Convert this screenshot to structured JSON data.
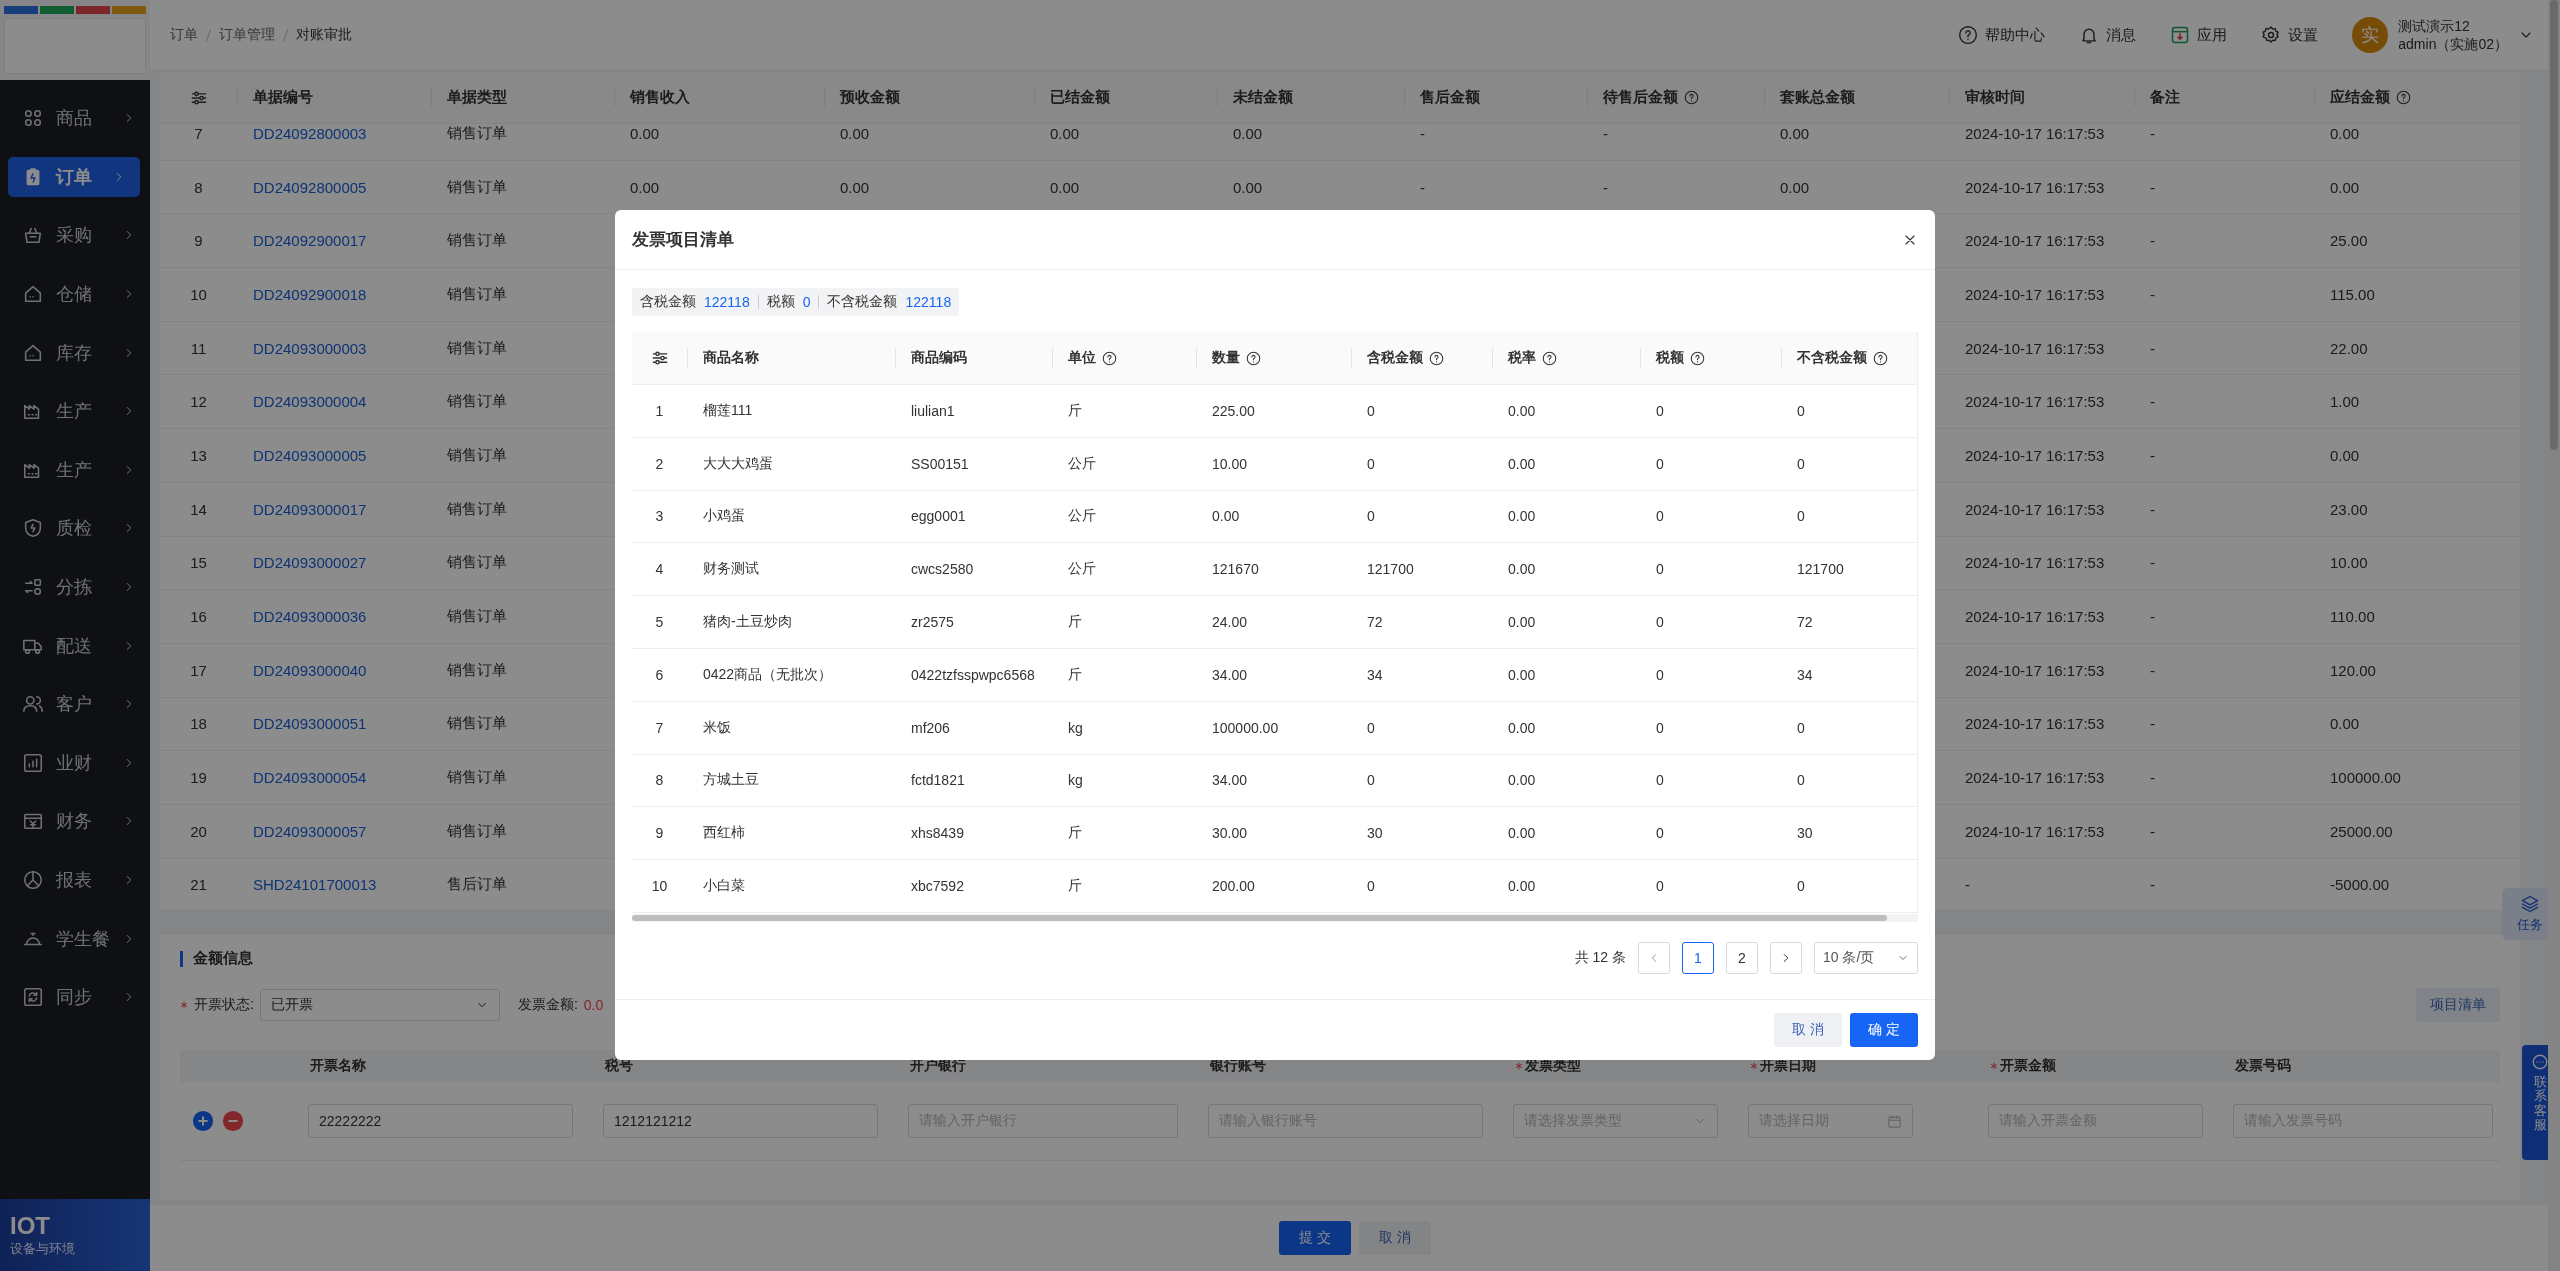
{
  "sidebar": {
    "items": [
      {
        "label": "商品",
        "selected": false
      },
      {
        "label": "订单",
        "selected": true
      },
      {
        "label": "采购",
        "selected": false
      },
      {
        "label": "仓储",
        "selected": false
      },
      {
        "label": "库存",
        "selected": false
      },
      {
        "label": "生产",
        "selected": false
      },
      {
        "label": "生产",
        "selected": false
      },
      {
        "label": "质检",
        "selected": false
      },
      {
        "label": "分拣",
        "selected": false
      },
      {
        "label": "配送",
        "selected": false
      },
      {
        "label": "客户",
        "selected": false
      },
      {
        "label": "业财",
        "selected": false
      },
      {
        "label": "财务",
        "selected": false
      },
      {
        "label": "报表",
        "selected": false
      },
      {
        "label": "学生餐",
        "selected": false
      },
      {
        "label": "同步",
        "selected": false
      }
    ],
    "footer": {
      "title": "IOT",
      "subtitle": "设备与环境"
    }
  },
  "header": {
    "breadcrumb": [
      "订单",
      "订单管理",
      "对账审批"
    ],
    "actions": [
      "帮助中心",
      "消息",
      "应用",
      "设置"
    ],
    "user": {
      "avatar": "实",
      "name": "测试演示12",
      "role": "admin（实施02）"
    }
  },
  "orders_table": {
    "columns": [
      {
        "kind": "index"
      },
      {
        "label": "单据编号",
        "kind": "link",
        "help": false
      },
      {
        "label": "单据类型",
        "kind": "text",
        "help": false
      },
      {
        "label": "销售收入",
        "kind": "text",
        "help": false
      },
      {
        "label": "预收金额",
        "kind": "text",
        "help": false
      },
      {
        "label": "已结金额",
        "kind": "text",
        "help": false
      },
      {
        "label": "未结金额",
        "kind": "text",
        "help": false
      },
      {
        "label": "售后金额",
        "kind": "text",
        "help": false
      },
      {
        "label": "待售后金额",
        "kind": "text",
        "help": true
      },
      {
        "label": "套账总金额",
        "kind": "text",
        "help": false
      },
      {
        "label": "审核时间",
        "kind": "text",
        "help": false
      },
      {
        "label": "备注",
        "kind": "text",
        "help": false
      },
      {
        "label": "应结金额",
        "kind": "text",
        "help": true
      }
    ],
    "rows": [
      [
        "7",
        "DD24092800003",
        "销售订单",
        "0.00",
        "0.00",
        "0.00",
        "0.00",
        "-",
        "-",
        "0.00",
        "2024-10-17 16:17:53",
        "-",
        "0.00"
      ],
      [
        "8",
        "DD24092800005",
        "销售订单",
        "0.00",
        "0.00",
        "0.00",
        "0.00",
        "-",
        "-",
        "0.00",
        "2024-10-17 16:17:53",
        "-",
        "0.00"
      ],
      [
        "9",
        "DD24092900017",
        "销售订单",
        null,
        null,
        null,
        null,
        null,
        null,
        null,
        "2024-10-17 16:17:53",
        "-",
        "25.00"
      ],
      [
        "10",
        "DD24092900018",
        "销售订单",
        null,
        null,
        null,
        null,
        null,
        null,
        null,
        "2024-10-17 16:17:53",
        "-",
        "115.00"
      ],
      [
        "11",
        "DD24093000003",
        "销售订单",
        null,
        null,
        null,
        null,
        null,
        null,
        null,
        "2024-10-17 16:17:53",
        "-",
        "22.00"
      ],
      [
        "12",
        "DD24093000004",
        "销售订单",
        null,
        null,
        null,
        null,
        null,
        null,
        null,
        "2024-10-17 16:17:53",
        "-",
        "1.00"
      ],
      [
        "13",
        "DD24093000005",
        "销售订单",
        null,
        null,
        null,
        null,
        null,
        null,
        null,
        "2024-10-17 16:17:53",
        "-",
        "0.00"
      ],
      [
        "14",
        "DD24093000017",
        "销售订单",
        null,
        null,
        null,
        null,
        null,
        null,
        null,
        "2024-10-17 16:17:53",
        "-",
        "23.00"
      ],
      [
        "15",
        "DD24093000027",
        "销售订单",
        null,
        null,
        null,
        null,
        null,
        null,
        null,
        "2024-10-17 16:17:53",
        "-",
        "10.00"
      ],
      [
        "16",
        "DD24093000036",
        "销售订单",
        null,
        null,
        null,
        null,
        null,
        null,
        null,
        "2024-10-17 16:17:53",
        "-",
        "110.00"
      ],
      [
        "17",
        "DD24093000040",
        "销售订单",
        null,
        null,
        null,
        null,
        null,
        null,
        null,
        "2024-10-17 16:17:53",
        "-",
        "120.00"
      ],
      [
        "18",
        "DD24093000051",
        "销售订单",
        null,
        null,
        null,
        null,
        null,
        null,
        null,
        "2024-10-17 16:17:53",
        "-",
        "0.00"
      ],
      [
        "19",
        "DD24093000054",
        "销售订单",
        null,
        null,
        null,
        null,
        null,
        null,
        null,
        "2024-10-17 16:17:53",
        "-",
        "100000.00"
      ],
      [
        "20",
        "DD24093000057",
        "销售订单",
        null,
        null,
        null,
        null,
        null,
        null,
        null,
        "2024-10-17 16:17:53",
        "-",
        "25000.00"
      ],
      [
        "21",
        "SHD24101700013",
        "售后订单",
        null,
        null,
        null,
        null,
        null,
        null,
        null,
        "-",
        "-",
        "-5000.00"
      ]
    ]
  },
  "amount_info": {
    "title": "金额信息",
    "invoice_status": {
      "label": "开票状态:",
      "required": true,
      "value": "已开票"
    },
    "invoice_amount": {
      "label": "发票金额:",
      "value": "0.0"
    },
    "items_button": "项目清单",
    "invoice_columns": [
      {
        "label": "开票名称",
        "required": false
      },
      {
        "label": "税号",
        "required": false
      },
      {
        "label": "开户银行",
        "required": false
      },
      {
        "label": "银行账号",
        "required": false
      },
      {
        "label": "发票类型",
        "required": true
      },
      {
        "label": "开票日期",
        "required": true
      },
      {
        "label": "开票金额",
        "required": true
      },
      {
        "label": "发票号码",
        "required": false
      }
    ],
    "invoice_row": [
      {
        "kind": "input",
        "value": "22222222"
      },
      {
        "kind": "input",
        "value": "1212121212"
      },
      {
        "kind": "input",
        "placeholder": "请输入开户银行"
      },
      {
        "kind": "input",
        "placeholder": "请输入银行账号"
      },
      {
        "kind": "select",
        "placeholder": "请选择发票类型"
      },
      {
        "kind": "date",
        "placeholder": "请选择日期"
      },
      {
        "kind": "input",
        "placeholder": "请输入开票金额"
      },
      {
        "kind": "input",
        "placeholder": "请输入发票号码"
      }
    ]
  },
  "footer_buttons": [
    {
      "label": "提 交",
      "kind": "primary"
    },
    {
      "label": "取 消",
      "kind": "default"
    }
  ],
  "floating": {
    "task": "任务",
    "support": "联系客服"
  },
  "modal": {
    "title": "发票项目清单",
    "summary": [
      {
        "label": "含税金额",
        "value": "122118"
      },
      {
        "label": "税额",
        "value": "0"
      },
      {
        "label": "不含税金额",
        "value": "122118"
      }
    ],
    "columns": [
      {
        "kind": "index"
      },
      {
        "label": "商品名称",
        "help": false
      },
      {
        "label": "商品编码",
        "help": false
      },
      {
        "label": "单位",
        "help": true
      },
      {
        "label": "数量",
        "help": true
      },
      {
        "label": "含税金额",
        "help": true
      },
      {
        "label": "税率",
        "help": true
      },
      {
        "label": "税额",
        "help": true
      },
      {
        "label": "不含税金额",
        "help": true
      }
    ],
    "rows": [
      [
        "1",
        "榴莲111",
        "liulian1",
        "斤",
        "225.00",
        "0",
        "0.00",
        "0",
        "0"
      ],
      [
        "2",
        "大大大鸡蛋",
        "SS00151",
        "公斤",
        "10.00",
        "0",
        "0.00",
        "0",
        "0"
      ],
      [
        "3",
        "小鸡蛋",
        "egg0001",
        "公斤",
        "0.00",
        "0",
        "0.00",
        "0",
        "0"
      ],
      [
        "4",
        "财务测试",
        "cwcs2580",
        "公斤",
        "121670",
        "121700",
        "0.00",
        "0",
        "121700"
      ],
      [
        "5",
        "猪肉-土豆炒肉",
        "zr2575",
        "斤",
        "24.00",
        "72",
        "0.00",
        "0",
        "72"
      ],
      [
        "6",
        "0422商品（无批次）",
        "0422tzfsspwpc6568",
        "斤",
        "34.00",
        "34",
        "0.00",
        "0",
        "34"
      ],
      [
        "7",
        "米饭",
        "mf206",
        "kg",
        "100000.00",
        "0",
        "0.00",
        "0",
        "0"
      ],
      [
        "8",
        "方城土豆",
        "fctd1821",
        "kg",
        "34.00",
        "0",
        "0.00",
        "0",
        "0"
      ],
      [
        "9",
        "西红柿",
        "xhs8439",
        "斤",
        "30.00",
        "30",
        "0.00",
        "0",
        "30"
      ],
      [
        "10",
        "小白菜",
        "xbc7592",
        "斤",
        "200.00",
        "0",
        "0.00",
        "0",
        "0"
      ]
    ],
    "pagination": {
      "total": "共 12 条",
      "pages": [
        {
          "label": "1",
          "selected": true
        },
        {
          "label": "2",
          "selected": false
        }
      ],
      "page_size": "10 条/页"
    },
    "buttons": [
      {
        "label": "取 消",
        "kind": "default"
      },
      {
        "label": "确 定",
        "kind": "primary"
      }
    ]
  }
}
